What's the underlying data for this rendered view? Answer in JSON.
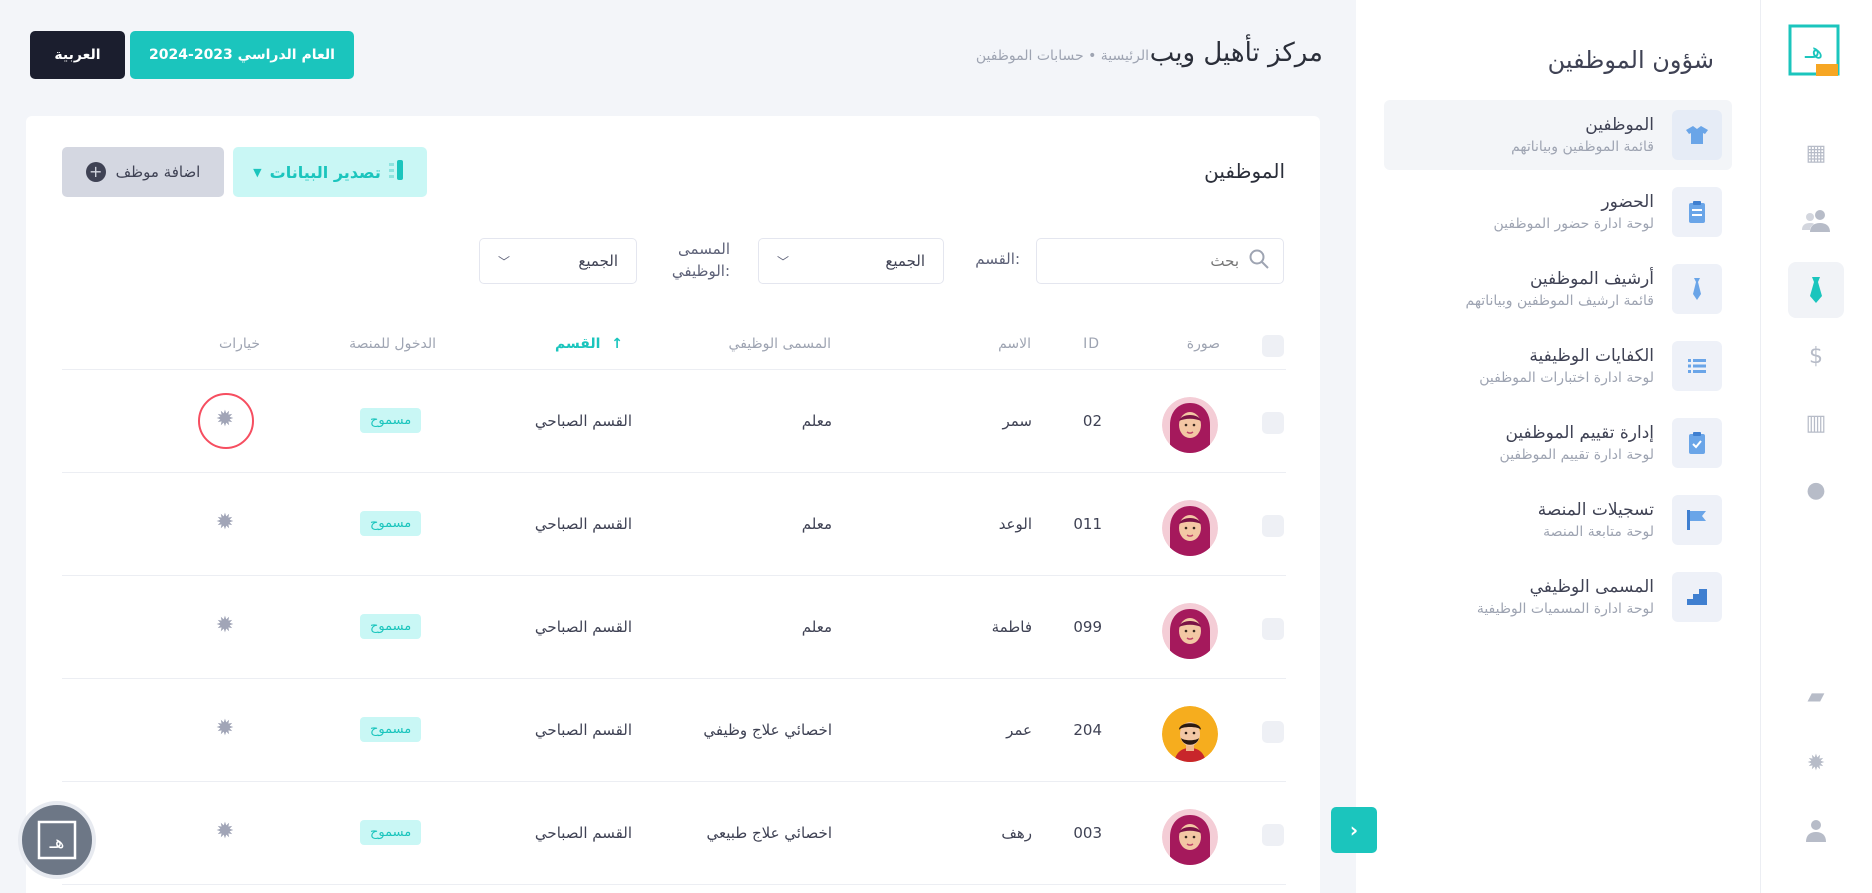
{
  "header": {
    "title": "مركز تأهيل ويب",
    "breadcrumb": "الرئيسية • حسابات الموظفين",
    "year_button": "العام الدراسي 2023-2024",
    "language_button": "العربية"
  },
  "sidebar": {
    "title": "شؤون الموظفين",
    "items": [
      {
        "title": "الموظفين",
        "subtitle": "قائمة الموظفين وبياناتهم",
        "icon": "shirt-icon"
      },
      {
        "title": "الحضور",
        "subtitle": "لوحة ادارة حضور الموظفين",
        "icon": "clipboard-icon"
      },
      {
        "title": "أرشيف الموظفين",
        "subtitle": "قائمة ارشيف الموظفين وبياناتهم",
        "icon": "tie-icon"
      },
      {
        "title": "الكفايات الوظيفية",
        "subtitle": "لوحة ادارة اختبارات الموظفين",
        "icon": "list-icon"
      },
      {
        "title": "إدارة تقييم الموظفين",
        "subtitle": "لوحة ادارة تقييم الموظفين",
        "icon": "clipboard-check-icon"
      },
      {
        "title": "تسجيلات المنصة",
        "subtitle": "لوحة متابعة المنصة",
        "icon": "flag-icon"
      },
      {
        "title": "المسمى الوظيفي",
        "subtitle": "لوحة ادارة المسميات الوظيفية",
        "icon": "stairs-icon"
      }
    ]
  },
  "card": {
    "title": "الموظفين",
    "add_button": "اضافة موظف",
    "export_button": "تصدير البيانات"
  },
  "filters": {
    "search_placeholder": "بحث",
    "department_label": "القسم:",
    "department_value": "الجميع",
    "jobtitle_label": "المسمى الوظيفي:",
    "jobtitle_value": "الجميع"
  },
  "table": {
    "headers": {
      "photo": "صورة",
      "id": "ID",
      "name": "الاسم",
      "jobtitle": "المسمى الوظيفي",
      "department": "القسم",
      "access": "الدخول للمنصة",
      "options": "خيارات"
    },
    "rows": [
      {
        "id": "02",
        "name": "سمر",
        "jobtitle": "معلم",
        "department": "القسم الصباحي",
        "access": "مسموح",
        "avatar": "female"
      },
      {
        "id": "011",
        "name": "الوعد",
        "jobtitle": "معلم",
        "department": "القسم الصباحي",
        "access": "مسموح",
        "avatar": "female"
      },
      {
        "id": "099",
        "name": "فاطمة",
        "jobtitle": "معلم",
        "department": "القسم الصباحي",
        "access": "مسموح",
        "avatar": "female"
      },
      {
        "id": "204",
        "name": "عمر",
        "jobtitle": "اخصائي علاج وظيفي",
        "department": "القسم الصباحي",
        "access": "مسموح",
        "avatar": "male"
      },
      {
        "id": "003",
        "name": "رهف",
        "jobtitle": "اخصائي علاج طبيعي",
        "department": "القسم الصباحي",
        "access": "مسموح",
        "avatar": "female"
      }
    ]
  },
  "colors": {
    "accent": "#1bc5bd",
    "dark": "#1b1e2e",
    "highlight_circle": "#f64e60"
  }
}
